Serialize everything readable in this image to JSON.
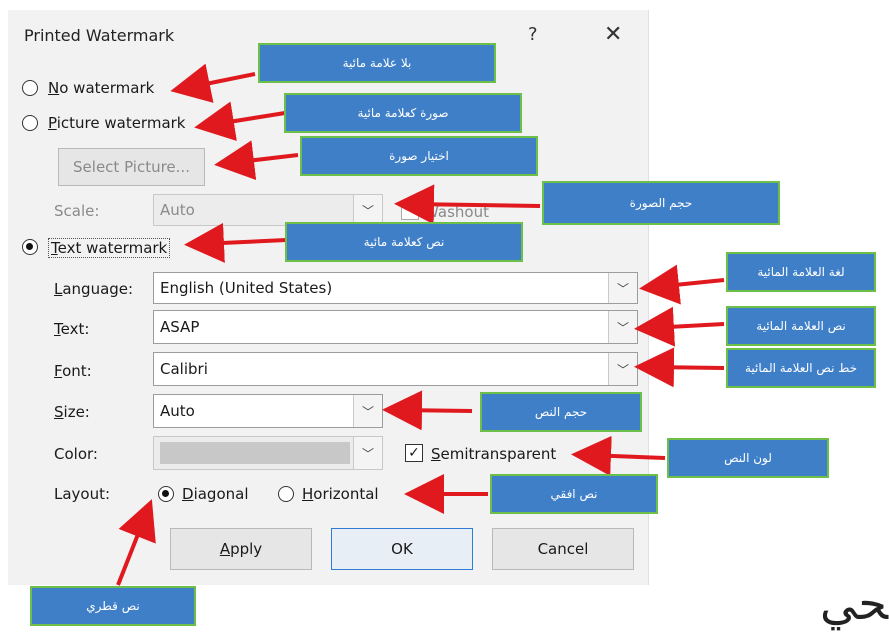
{
  "dialog": {
    "title": "Printed Watermark",
    "help_glyph": "?",
    "close_glyph": "✕",
    "no_watermark": {
      "label_accel": "N",
      "label_rest": "o watermark",
      "selected": false
    },
    "picture_watermark": {
      "label_accel": "P",
      "label_rest": "icture watermark",
      "selected": false
    },
    "select_picture_label": "Select Picture...",
    "scale": {
      "label": "Scale:",
      "value": "Auto"
    },
    "washout_label": "Washout",
    "text_watermark": {
      "label_accel": "T",
      "label_rest": "ext watermark",
      "selected": true
    },
    "language": {
      "label_accel": "L",
      "label_rest": "anguage:",
      "value": "English (United States)"
    },
    "text": {
      "label_accel": "T",
      "label_rest": "ext:",
      "value": "ASAP"
    },
    "font": {
      "label_accel": "F",
      "label_rest": "ont:",
      "value": "Calibri"
    },
    "size": {
      "label_accel": "S",
      "label_rest": "ize:",
      "value": "Auto"
    },
    "color": {
      "label": "Color:",
      "value": ""
    },
    "semitransparent": {
      "label_accel": "S",
      "label_rest": "emitransparent",
      "checked": true
    },
    "layout": {
      "label": "Layout:"
    },
    "diagonal": {
      "label_accel": "D",
      "label_rest": "iagonal",
      "selected": true
    },
    "horizontal": {
      "label_accel": "H",
      "label_rest": "orizontal",
      "selected": false
    },
    "apply_accel": "A",
    "apply_rest": "pply",
    "ok_label": "OK",
    "cancel_label": "Cancel"
  },
  "callouts": {
    "no_watermark": "بلا علامة مائية",
    "picture_watermark": "صورة كعلامة مائية",
    "select_picture": "اختيار صورة",
    "scale": "حجم الصورة",
    "text_watermark": "نص كعلامة مائية",
    "language": "لغة العلامة المائية",
    "text": "نص العلامة المائية",
    "font": "خط نص العلامة المائية",
    "size": "حجم النص",
    "color": "لون النص",
    "horizontal": "نص افقي",
    "diagonal": "نص قطري"
  },
  "logo_text": "ﺤﻲ",
  "colors": {
    "callout_fill": "#3f7fc8",
    "callout_border": "#6cc04a",
    "arrow": "#e0191f"
  }
}
